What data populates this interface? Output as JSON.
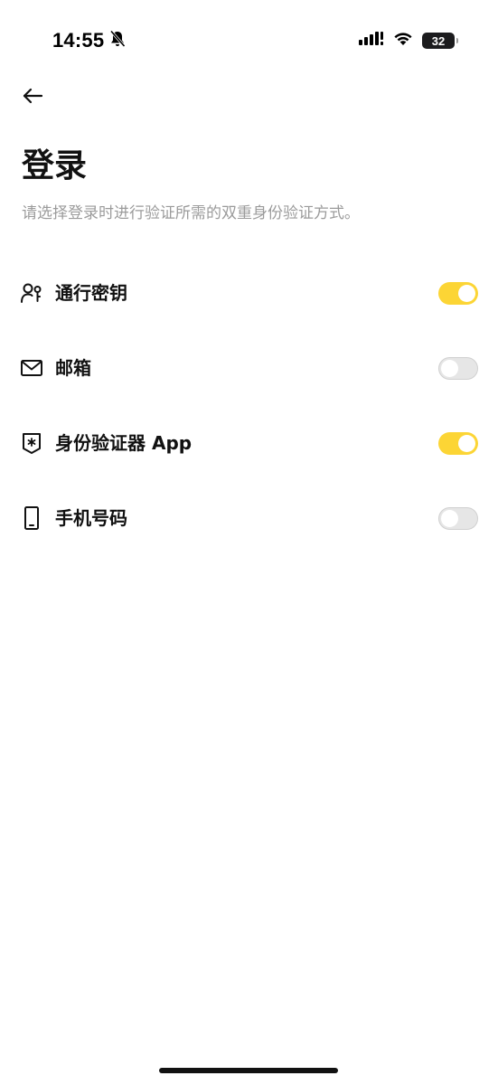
{
  "status_bar": {
    "time": "14:55",
    "battery": "32",
    "icons": [
      "bell-slash-icon",
      "cellular-signal-icon",
      "wifi-icon",
      "battery-icon"
    ]
  },
  "header": {
    "back_icon": "arrow-left-icon",
    "title": "登录",
    "subtitle": "请选择登录时进行验证所需的双重身份验证方式。"
  },
  "options": [
    {
      "label": "通行密钥",
      "icon": "passkey-user-icon",
      "enabled": true
    },
    {
      "label": "邮箱",
      "icon": "mail-icon",
      "enabled": false
    },
    {
      "label": "身份验证器 App",
      "icon": "authenticator-shield-icon",
      "enabled": true
    },
    {
      "label": "手机号码",
      "icon": "phone-icon",
      "enabled": false
    }
  ],
  "colors": {
    "accent": "#fcd535",
    "toggle_off": "#e6e6e6",
    "subtitle": "#9b9b9b",
    "text": "#111111"
  }
}
